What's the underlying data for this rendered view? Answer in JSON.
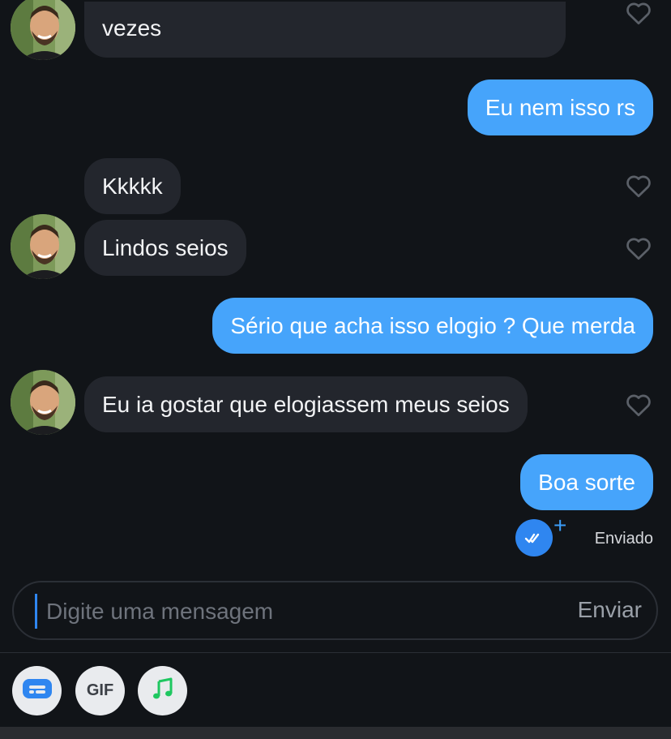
{
  "messages": [
    {
      "sender": "them",
      "text": "vezes",
      "avatar": true,
      "heart": true
    },
    {
      "sender": "me",
      "text": "Eu nem isso rs"
    },
    {
      "sender": "them",
      "text": "Kkkkk",
      "avatar": false,
      "heart": true
    },
    {
      "sender": "them",
      "text": "Lindos seios",
      "avatar": true,
      "heart": true
    },
    {
      "sender": "me",
      "text": "Sério que acha isso elogio ? Que merda"
    },
    {
      "sender": "them",
      "text": "Eu ia gostar que elogiassem meus seios",
      "avatar": true,
      "heart": true
    },
    {
      "sender": "me",
      "text": "Boa sorte"
    }
  ],
  "status": {
    "label": "Enviado",
    "icon": "double-check-icon"
  },
  "composer": {
    "placeholder": "Digite uma mensagem",
    "value": "",
    "send_label": "Enviar"
  },
  "toolbar": {
    "sticker_icon": "sticker-card-icon",
    "gif_label": "GIF",
    "music_icon": "music-note-icon"
  },
  "colors": {
    "background": "#111418",
    "their_bubble": "#23262d",
    "my_bubble": "#46a4fb",
    "accent": "#2f86f0",
    "music": "#1ec760"
  }
}
